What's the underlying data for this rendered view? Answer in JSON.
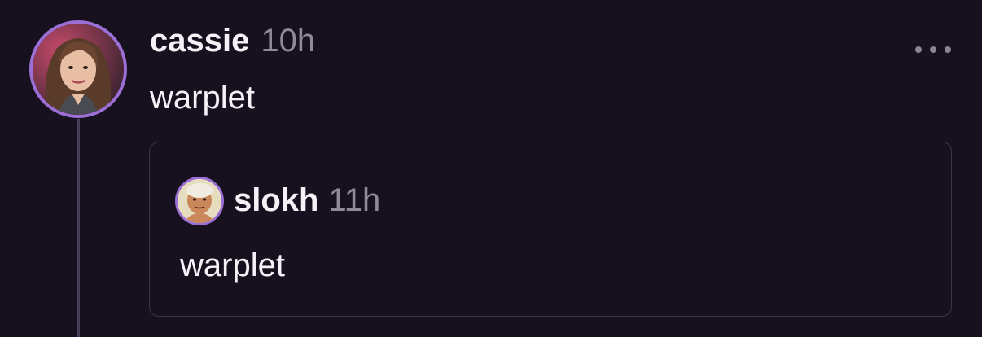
{
  "post": {
    "username": "cassie",
    "time": "10h",
    "text": "warplet",
    "avatar_icon": "profile-photo-woman"
  },
  "quote": {
    "username": "slokh",
    "time": "11h",
    "text": "warplet",
    "avatar_icon": "cartoon-face-avatar"
  },
  "colors": {
    "background": "#17111f",
    "avatar_ring": "#9b6fd6",
    "muted_text": "#8f8a99",
    "primary_text": "#f4f1f7"
  }
}
